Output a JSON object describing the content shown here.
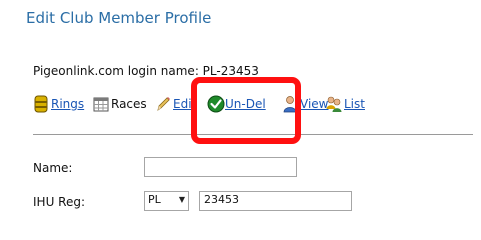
{
  "header": {
    "title": "Edit Club Member Profile"
  },
  "login": {
    "text": "Pigeonlink.com login name: PL-23453"
  },
  "toolbar": {
    "items": [
      {
        "label": "Rings",
        "icon": "rings-icon",
        "link": true
      },
      {
        "label": "Races",
        "icon": "races-icon",
        "link": false
      },
      {
        "label": "Edit",
        "icon": "pencil-icon",
        "link": true
      },
      {
        "label": "Un-Del",
        "icon": "check-icon",
        "link": true
      },
      {
        "label": "View",
        "icon": "person-icon",
        "link": true
      },
      {
        "label": "List",
        "icon": "users-icon",
        "link": true
      }
    ]
  },
  "form": {
    "name_label": "Name:",
    "name_value": "",
    "ihu_label": "IHU Reg:",
    "ihu_prefix": "PL",
    "ihu_number": "23453"
  },
  "colors": {
    "title": "#2b6ea6",
    "link": "#1a56b5",
    "highlight": "#ff1010"
  }
}
